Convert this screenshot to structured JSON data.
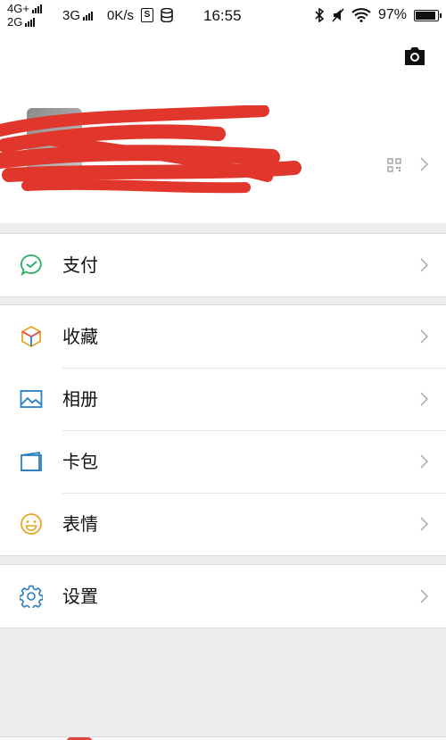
{
  "status_bar": {
    "net_top": "4G+",
    "net_bottom": "2G",
    "net_second": "3G",
    "speed": "0K/s",
    "time": "16:55",
    "battery": "97%",
    "battery_level": 0.97
  },
  "menu": {
    "pay": "支付",
    "favorites": "收藏",
    "album": "相册",
    "cards": "卡包",
    "stickers": "表情",
    "settings": "设置"
  },
  "colors": {
    "pay_green": "#2aae67",
    "link_blue": "#2a7fc1",
    "sticker_yellow": "#e8a41c",
    "redaction_red": "#e0362b"
  },
  "icons": {
    "camera": "camera-icon",
    "qr": "qr-code-icon",
    "pay": "wallet-check-icon",
    "favorites": "cube-icon",
    "album": "picture-icon",
    "cards": "card-wallet-icon",
    "stickers": "smiley-icon",
    "settings": "gear-icon"
  }
}
